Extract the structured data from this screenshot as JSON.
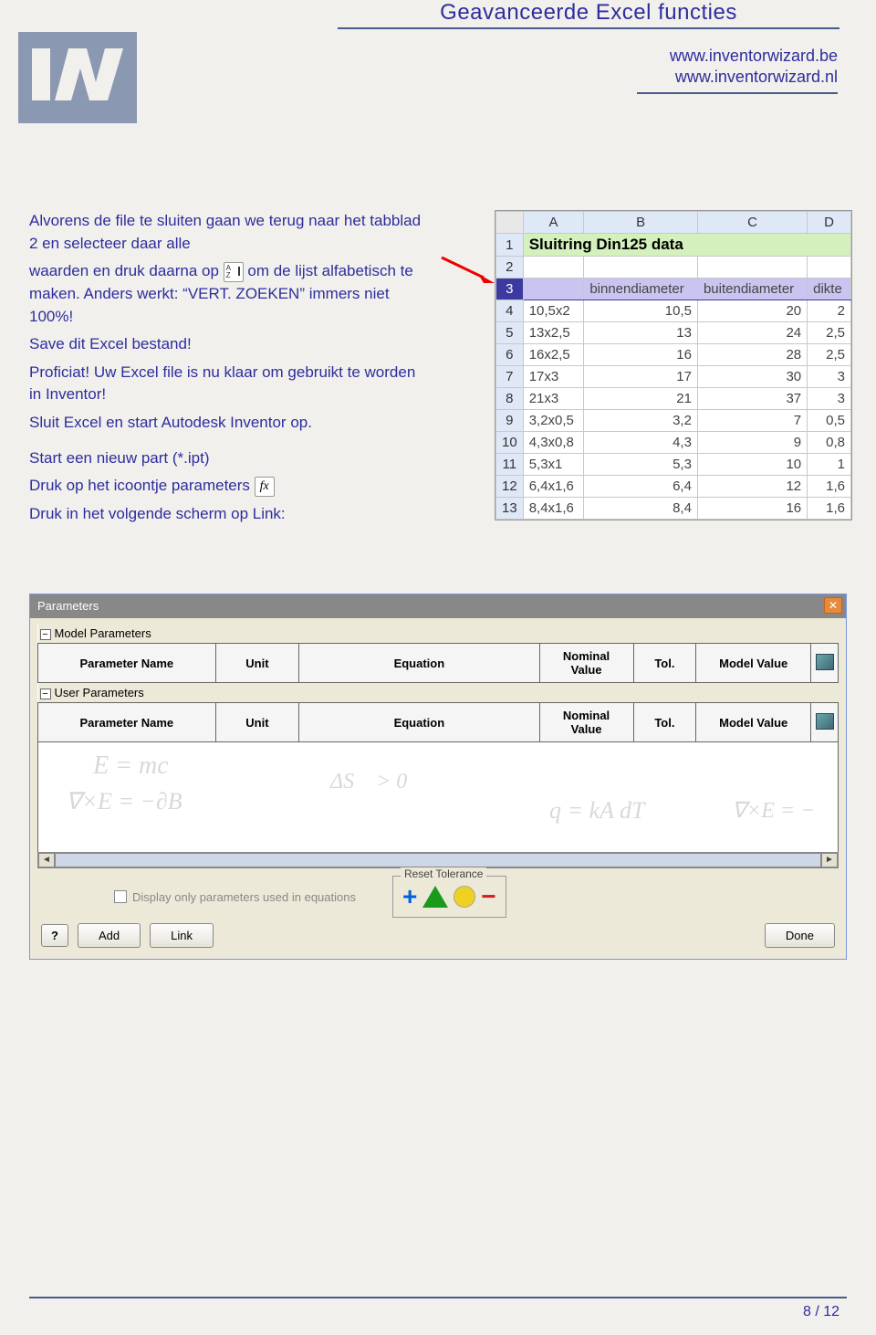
{
  "header": {
    "title": "Geavanceerde Excel functies",
    "url1": "www.inventorwizard.be",
    "url2": "www.inventorwizard.nl"
  },
  "body": {
    "p1": "Alvorens de file te sluiten gaan we terug naar het tabblad 2 en selecteer daar alle",
    "p2a": "waarden en druk daarna op ",
    "p2b": " om de lijst alfabetisch te maken. Anders werkt: “VERT. ZOEKEN” immers niet 100%!",
    "p3": "Save dit Excel bestand!",
    "p4": "Proficiat! Uw Excel file is nu klaar om gebruikt te worden in Inventor!",
    "p5": "Sluit Excel en start Autodesk Inventor op.",
    "p6": "Start een nieuw part (*.ipt)",
    "p7a": "Druk op het icoontje parameters ",
    "p8": "Druk in het volgende scherm op Link:"
  },
  "excel": {
    "columns": [
      "A",
      "B",
      "C",
      "D"
    ],
    "title": "Sluitring Din125 data",
    "headers": {
      "b": "binnendiameter",
      "c": "buitendiameter",
      "d": "dikte"
    },
    "rows": [
      {
        "n": 4,
        "a": "10,5x2",
        "b": "10,5",
        "c": "20",
        "d": "2"
      },
      {
        "n": 5,
        "a": "13x2,5",
        "b": "13",
        "c": "24",
        "d": "2,5"
      },
      {
        "n": 6,
        "a": "16x2,5",
        "b": "16",
        "c": "28",
        "d": "2,5"
      },
      {
        "n": 7,
        "a": "17x3",
        "b": "17",
        "c": "30",
        "d": "3"
      },
      {
        "n": 8,
        "a": "21x3",
        "b": "21",
        "c": "37",
        "d": "3"
      },
      {
        "n": 9,
        "a": "3,2x0,5",
        "b": "3,2",
        "c": "7",
        "d": "0,5"
      },
      {
        "n": 10,
        "a": "4,3x0,8",
        "b": "4,3",
        "c": "9",
        "d": "0,8"
      },
      {
        "n": 11,
        "a": "5,3x1",
        "b": "5,3",
        "c": "10",
        "d": "1"
      },
      {
        "n": 12,
        "a": "6,4x1,6",
        "b": "6,4",
        "c": "12",
        "d": "1,6"
      },
      {
        "n": 13,
        "a": "8,4x1,6",
        "b": "8,4",
        "c": "16",
        "d": "1,6"
      }
    ]
  },
  "dialog": {
    "title": "Parameters",
    "group1": "Model Parameters",
    "group2": "User Parameters",
    "cols": {
      "name": "Parameter Name",
      "unit": "Unit",
      "eq": "Equation",
      "nom": "Nominal Value",
      "tol": "Tol.",
      "mv": "Model Value"
    },
    "checkbox": "Display only parameters used in equations",
    "reset": "Reset Tolerance",
    "add": "Add",
    "link": "Link",
    "done": "Done",
    "help": "?"
  },
  "footer": {
    "page": "8 / 12"
  },
  "icons": {
    "fx": "fx"
  }
}
